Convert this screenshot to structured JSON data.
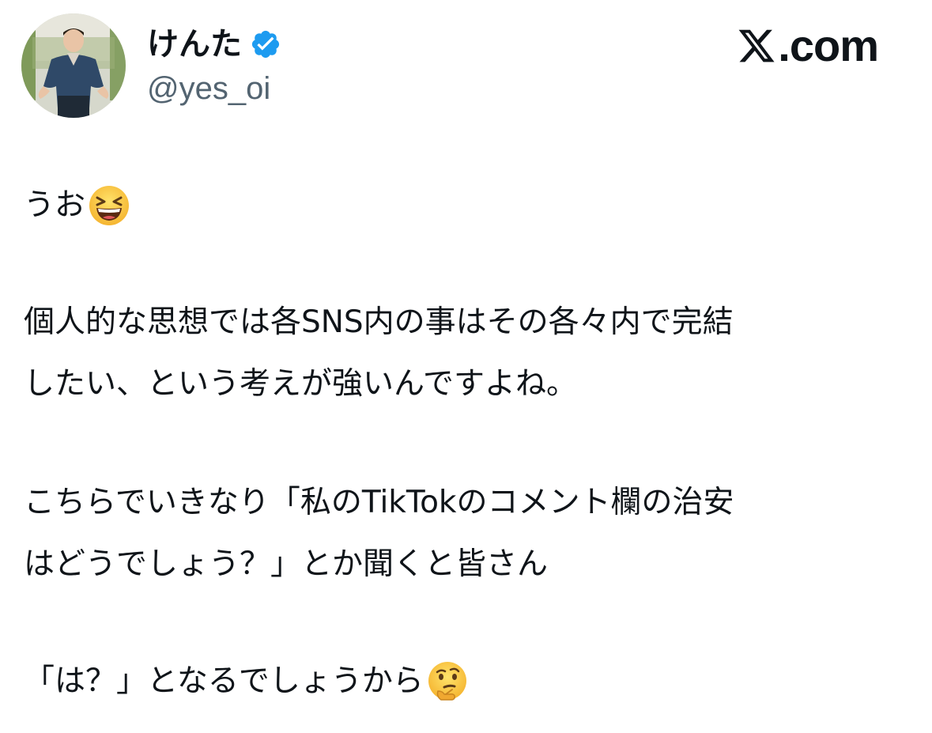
{
  "author": {
    "display_name": "けんた",
    "handle": "@yes_oi",
    "verified": true,
    "verified_color": "#1d9bf0"
  },
  "brand": {
    "text": ".com",
    "logo_icon": "x-logo-icon"
  },
  "tweet": {
    "lines": [
      "うお",
      "個人的な思想では各SNS内の事はその各々内で完結",
      "したい、という考えが強いんですよね。",
      "こちらでいきなり「私のTikTokのコメント欄の治安",
      "はどうでしょう？」とか聞くと皆さん",
      "「は？」となるでしょうから"
    ],
    "emojis": [
      "grinning-squinting-face-emoji",
      "thinking-face-emoji"
    ]
  },
  "colors": {
    "text": "#0f1419",
    "secondary_text": "#536471"
  }
}
